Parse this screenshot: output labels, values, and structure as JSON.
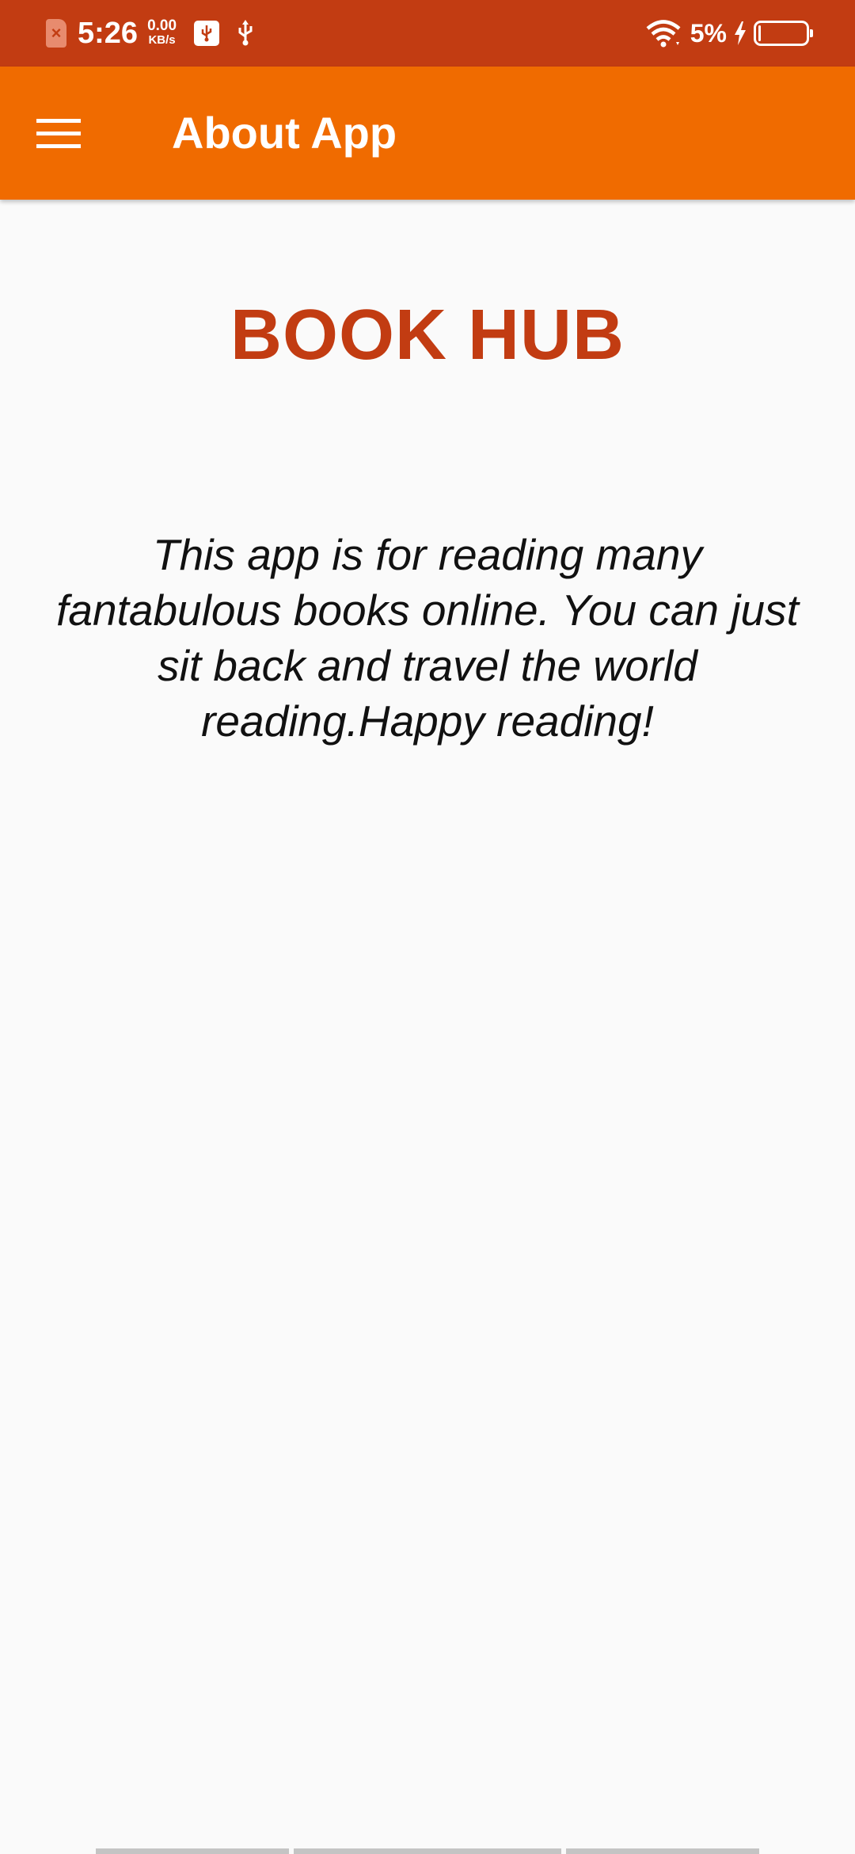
{
  "status_bar": {
    "time": "5:26",
    "net_speed_value": "0.00",
    "net_speed_unit": "KB/s",
    "battery_percent_text": "5%",
    "battery_level": 0.05,
    "icons": [
      "sim-error-icon",
      "usb-debug-icon",
      "usb-icon",
      "wifi-icon",
      "charging-icon",
      "battery-icon"
    ]
  },
  "app_bar": {
    "title": "About App",
    "menu_icon": "hamburger-menu-icon",
    "color": "#f06b00"
  },
  "content": {
    "heading": "BOOK HUB",
    "description": "This app is for reading many fantabulous books online. You can just sit back and travel the world reading.Happy reading!"
  },
  "colors": {
    "status_bar": "#c23c12",
    "accent": "#c23c12",
    "background": "#fafafa"
  }
}
